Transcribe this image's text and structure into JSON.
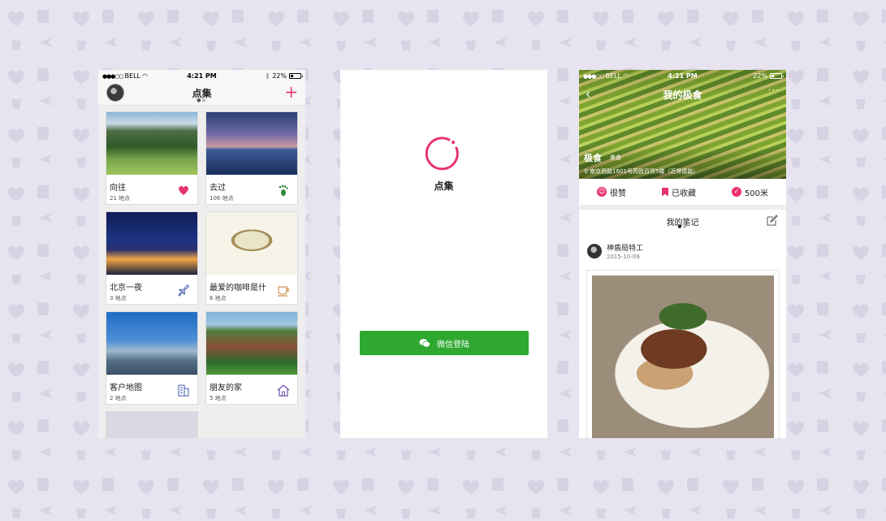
{
  "theme": {
    "accent": "#e8336d",
    "wechat_green": "#2ea82f",
    "background": "#e7e4ef"
  },
  "phone1": {
    "status": {
      "carrier": "BELL",
      "time": "4:21 PM",
      "battery": "22%"
    },
    "header": {
      "title": "点集",
      "add_icon": "plus-icon"
    },
    "cards": [
      {
        "name": "向往",
        "count": "21 地点",
        "icon": "heart-icon"
      },
      {
        "name": "去过",
        "count": "106 地点",
        "icon": "footprint-icon"
      },
      {
        "name": "北京一夜",
        "count": "3 地点",
        "icon": "airplane-icon"
      },
      {
        "name": "最爱的咖啡是什",
        "count": "6 地点",
        "icon": "coffee-cup-icon"
      },
      {
        "name": "客户地图",
        "count": "2 地点",
        "icon": "building-icon"
      },
      {
        "name": "朋友的家",
        "count": "5 地点",
        "icon": "home-icon"
      }
    ]
  },
  "phone2": {
    "title": "点集",
    "wechat_login": "微信登陆"
  },
  "phone3": {
    "status": {
      "carrier": "BELL",
      "time": "4:21 PM",
      "battery": "22%"
    },
    "header": {
      "title": "我的极食"
    },
    "hero": {
      "name": "极食",
      "tag": "美食",
      "address": "南京西路1601号芮欧百货5楼（近常德路）"
    },
    "actions": {
      "like": "很赞",
      "saved": "已收藏",
      "distance": "500米"
    },
    "notes": {
      "title": "我的笔记",
      "author": "神盾局特工",
      "date": "2015-10-09"
    }
  }
}
